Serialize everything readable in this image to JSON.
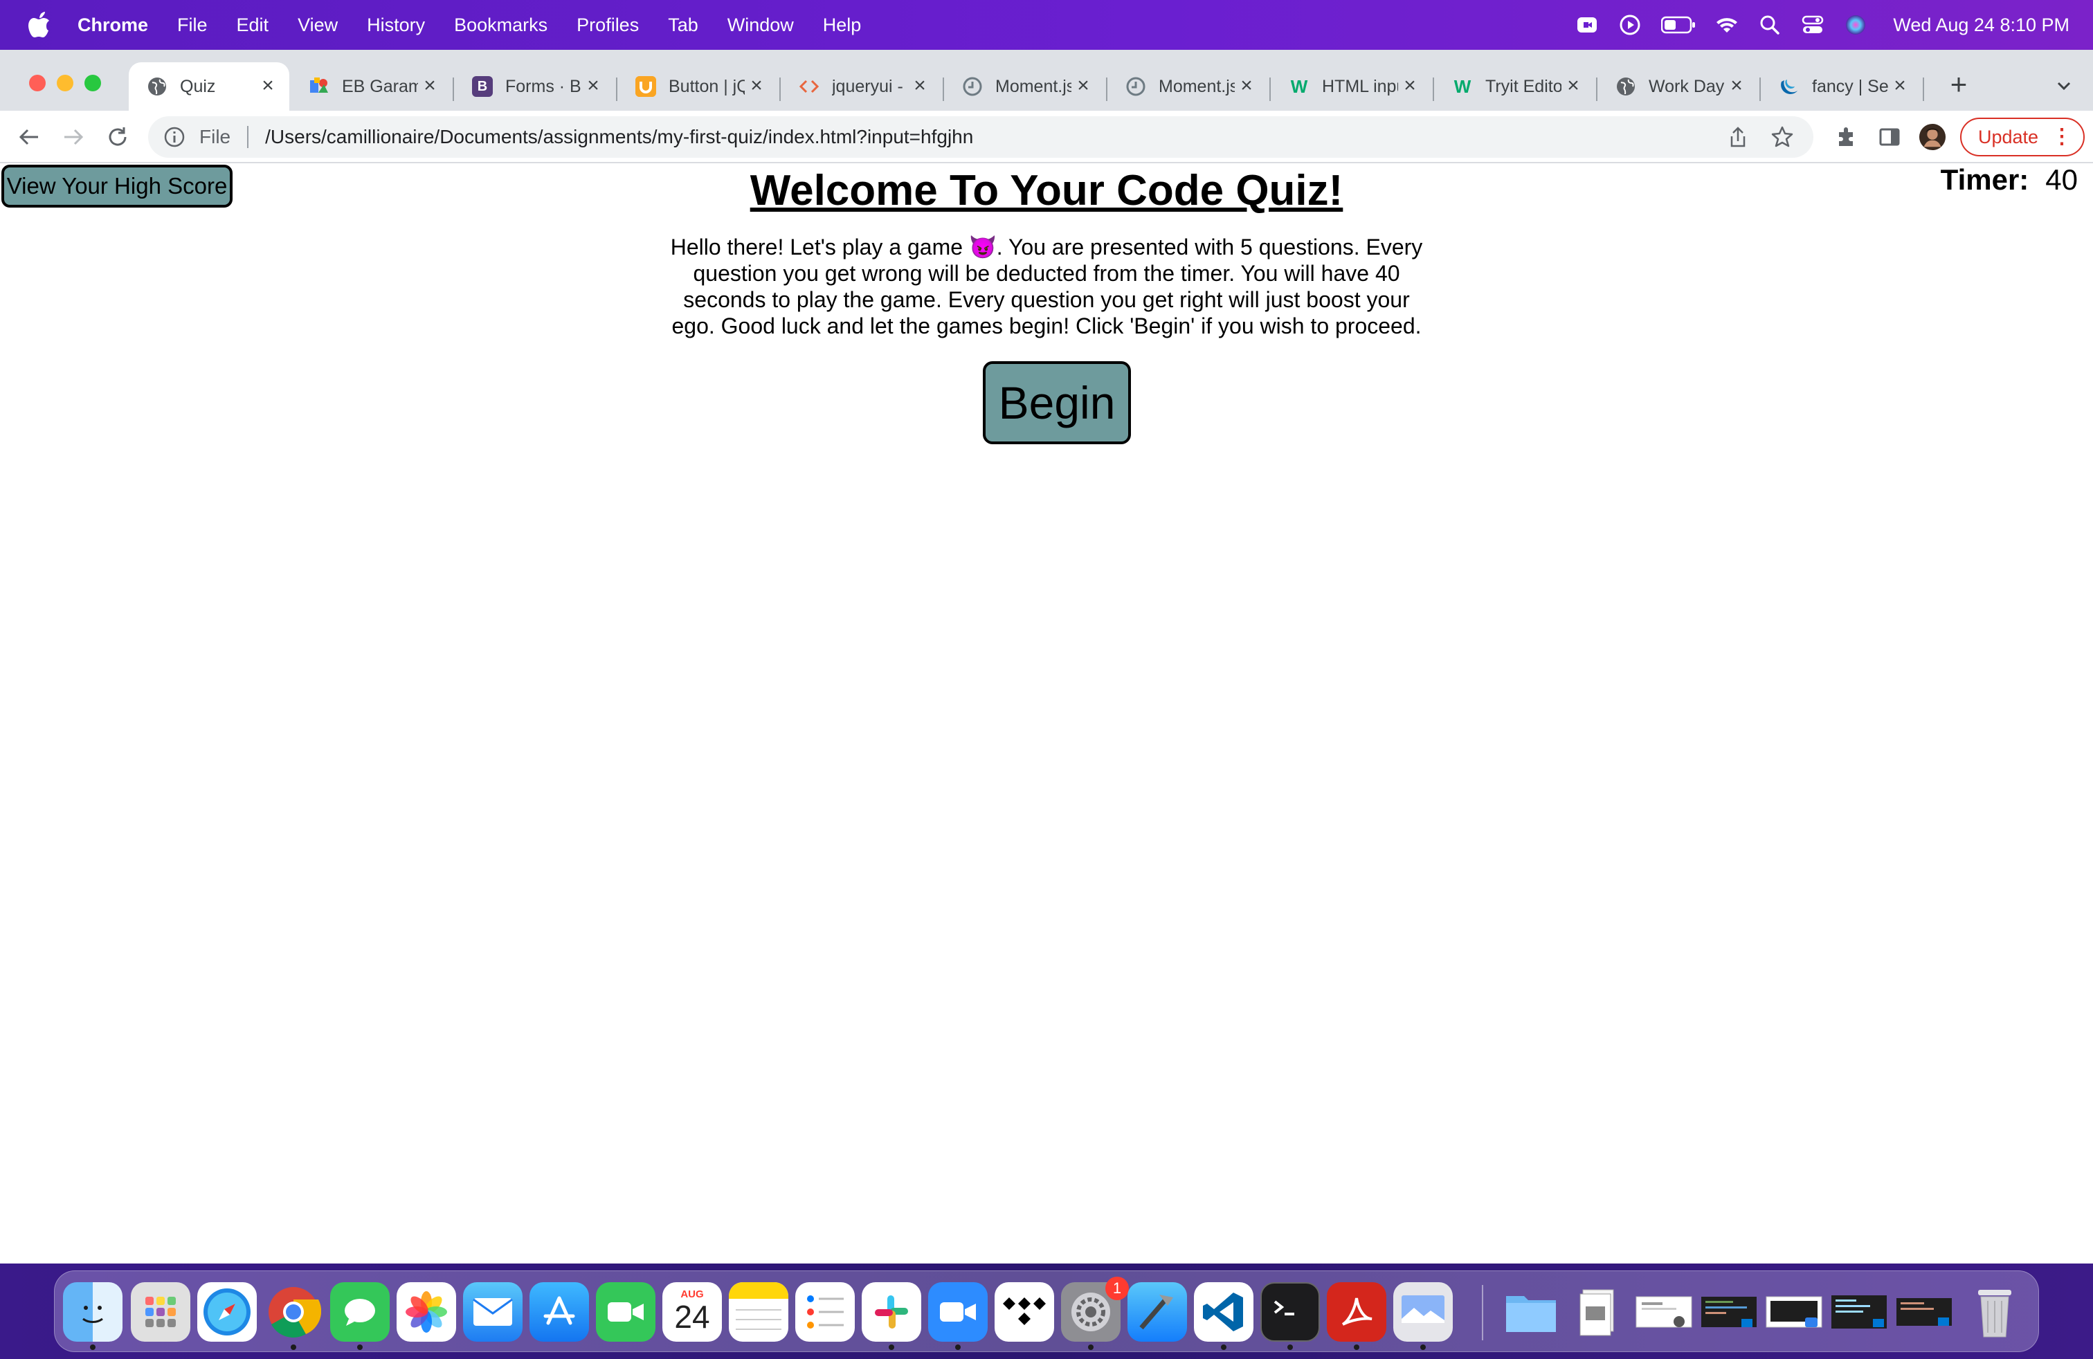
{
  "menubar": {
    "app_name": "Chrome",
    "items": [
      "File",
      "Edit",
      "View",
      "History",
      "Bookmarks",
      "Profiles",
      "Tab",
      "Window",
      "Help"
    ],
    "clock": "Wed Aug 24  8:10 PM"
  },
  "tabs": [
    {
      "title": "Quiz",
      "icon": "globe-icon"
    },
    {
      "title": "EB Garamond",
      "icon": "google-fonts-icon"
    },
    {
      "title": "Forms · Bootstrap",
      "icon": "bootstrap-icon"
    },
    {
      "title": "Button | jQuery UI",
      "icon": "jquery-ui-icon"
    },
    {
      "title": "jqueryui -",
      "icon": "code-icon"
    },
    {
      "title": "Moment.js",
      "icon": "clock-icon"
    },
    {
      "title": "Moment.js",
      "icon": "clock-icon"
    },
    {
      "title": "HTML input",
      "icon": "w3schools-icon"
    },
    {
      "title": "Tryit Editor",
      "icon": "w3schools-icon"
    },
    {
      "title": "Work Day",
      "icon": "globe-icon"
    },
    {
      "title": "fancy | Search",
      "icon": "jquery-icon"
    }
  ],
  "toolbar": {
    "scheme": "File",
    "url": "/Users/camillionaire/Documents/assignments/my-first-quiz/index.html?input=hfgjhn",
    "update_label": "Update"
  },
  "page": {
    "high_score_label": "View Your High Score",
    "title": "Welcome To Your Code Quiz!",
    "timer_label": "Timer:",
    "timer_value": "40",
    "intro": "Hello there! Let's play a game 😈. You are presented with 5 questions. Every question you get wrong will be deducted from the timer. You will have 40 seconds to play the game. Every question you get right will just boost your ego. Good luck and let the games begin! Click 'Begin' if you wish to proceed.",
    "begin_label": "Begin"
  },
  "dock": {
    "calendar_month": "AUG",
    "calendar_day": "24",
    "settings_badge": "1"
  },
  "colors": {
    "button_teal": "#6e9b9d",
    "menubar_purple": "#5a1cc0",
    "update_red": "#d93025"
  }
}
